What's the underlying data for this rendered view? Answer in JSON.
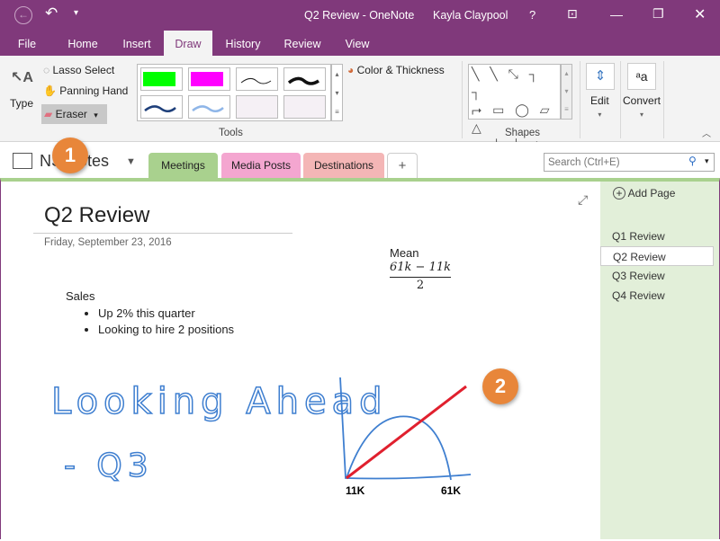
{
  "titlebar": {
    "title": "Q2 Review - OneNote",
    "user": "Kayla Claypool",
    "help": "?"
  },
  "menu": [
    "File",
    "Home",
    "Insert",
    "Draw",
    "History",
    "Review",
    "View"
  ],
  "ribbon": {
    "type": "Type",
    "lasso": "Lasso Select",
    "panning": "Panning Hand",
    "eraser": "Eraser",
    "color_thickness": "Color & Thickness",
    "tools_label": "Tools",
    "shapes_label": "Shapes",
    "edit": "Edit",
    "convert": "Convert"
  },
  "notebook": {
    "name": "NS Notes",
    "sections": [
      "Meetings",
      "Media Posts",
      "Destinations"
    ],
    "add": "+",
    "search_placeholder": "Search (Ctrl+E)"
  },
  "pane": {
    "add_page": "Add Page",
    "pages": [
      "Q1 Review",
      "Q2 Review",
      "Q3 Review",
      "Q4 Review"
    ],
    "selected": "Q2 Review"
  },
  "note": {
    "title": "Q2 Review",
    "date": "Friday, September 23, 2016",
    "mean_label": "Mean",
    "numerator": "61k − 11k",
    "denominator": "2",
    "sales": "Sales",
    "bullets": [
      "Up 2% this quarter",
      "Looking to hire 2 positions"
    ],
    "handwriting1": "Looking Ahead",
    "handwriting2": "- Q3",
    "graph_x1": "11K",
    "graph_x2": "61K"
  },
  "callouts": [
    "1",
    "2"
  ],
  "colors": {
    "brand": "#80397b",
    "section_meetings": "#a9d18e",
    "section_media": "#f4a6d0",
    "section_dest": "#f4b6b6",
    "ink_blue": "#3f7fd0",
    "ink_red": "#e0202e",
    "callout": "#e8863a"
  }
}
